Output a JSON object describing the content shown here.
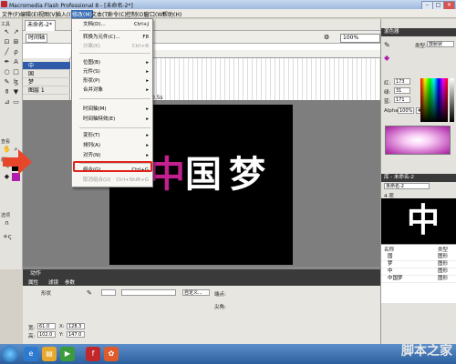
{
  "window": {
    "title": "Macromedia Flash Professional 8 - [未命名-2*]"
  },
  "menubar": [
    "文件(F)",
    "编辑(E)",
    "视图(V)",
    "插入(I)",
    "修改(M)",
    "文本(T)",
    "命令(C)",
    "控制(O)",
    "窗口(W)",
    "帮助(H)"
  ],
  "document": {
    "tab": "未命名-2*",
    "scene": "时间轴",
    "zoom": "100%",
    "fps": "0.5s"
  },
  "layers": [
    {
      "name": "中",
      "selected": true
    },
    {
      "name": "国",
      "selected": false
    },
    {
      "name": "梦",
      "selected": false
    },
    {
      "name": "图层 1",
      "selected": false
    }
  ],
  "stage_text": [
    "中",
    "国",
    "梦"
  ],
  "modify_menu": {
    "items": [
      {
        "label": "文档(D)...",
        "shortcut": "Ctrl+J",
        "disabled": false
      },
      {
        "label": "转换为元件(C)...",
        "shortcut": "F8",
        "disabled": false
      },
      {
        "label": "分离(K)",
        "shortcut": "Ctrl+B",
        "disabled": true
      },
      {
        "label": "位图(B)",
        "shortcut": "",
        "disabled": false
      },
      {
        "label": "元件(S)",
        "shortcut": "",
        "disabled": false
      },
      {
        "label": "形状(P)",
        "shortcut": "",
        "disabled": false
      },
      {
        "label": "合并对象",
        "shortcut": "",
        "disabled": false
      },
      {
        "label": "时间轴(M)",
        "shortcut": "",
        "disabled": false
      },
      {
        "label": "时间轴特效(E)",
        "shortcut": "",
        "disabled": false
      },
      {
        "label": "变形(T)",
        "shortcut": "",
        "disabled": false
      },
      {
        "label": "排列(A)",
        "shortcut": "",
        "disabled": false
      },
      {
        "label": "对齐(N)",
        "shortcut": "",
        "disabled": false
      },
      {
        "label": "组合(G)",
        "shortcut": "Ctrl+G",
        "disabled": false
      },
      {
        "label": "取消组合(U)",
        "shortcut": "Ctrl+Shift+G",
        "disabled": true
      }
    ]
  },
  "toolbox": {
    "tools_label": "工具",
    "view_label": "查看",
    "colors_label": "颜色",
    "options_label": "选项"
  },
  "color_panel": {
    "header": "混色器",
    "type_label": "类型:",
    "type_value": "放射状",
    "r": "173",
    "g": "31",
    "b": "171",
    "alpha_label": "Alpha:",
    "alpha": "100%",
    "hex": "#AD1FAB"
  },
  "library_panel": {
    "header": "库 - 未命名-2",
    "doc": "未命名-2",
    "count": "4 项",
    "col_name": "名称",
    "col_kind": "类型",
    "items": [
      {
        "name": "国",
        "kind": "图形"
      },
      {
        "name": "梦",
        "kind": "图形"
      },
      {
        "name": "中",
        "kind": "图形"
      },
      {
        "name": "中国梦",
        "kind": "图形"
      }
    ]
  },
  "actions_panel": {
    "label": "动作"
  },
  "property_tabs": [
    "属性",
    "滤镜",
    "参数"
  ],
  "properties": {
    "shape_label": "形状",
    "w_label": "宽:",
    "w": "61.0",
    "h_label": "高:",
    "h": "102.0",
    "x_label": "X:",
    "x": "128.3",
    "y_label": "Y:",
    "y": "147.0",
    "custom": "自定义...",
    "cap_label": "端点:",
    "join_label": "尖角:"
  },
  "watermark": {
    "site": "jb51.net",
    "name": "脚本之家"
  },
  "colors": {
    "highlight": "#e0231c",
    "arrow": "#e8462a",
    "selection": "#2f5ba8"
  }
}
